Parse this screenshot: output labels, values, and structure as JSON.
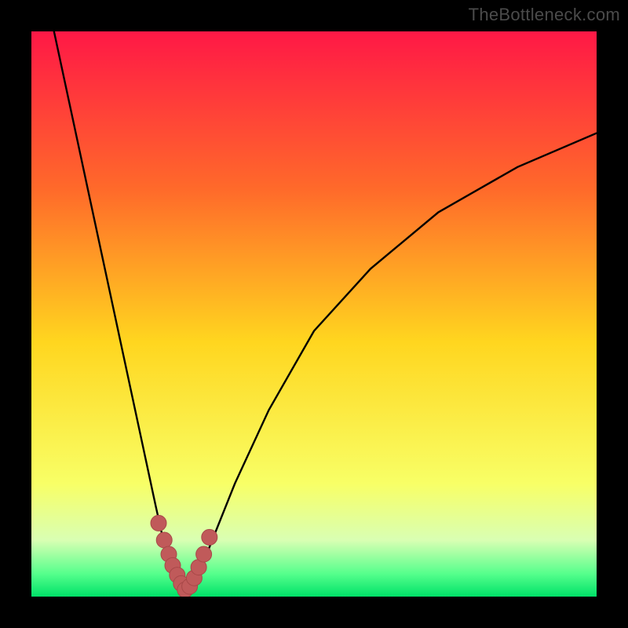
{
  "watermark": "TheBottleneck.com",
  "colors": {
    "grad_top": "#ff1846",
    "grad_upper": "#ff6a2a",
    "grad_mid": "#ffd61f",
    "grad_lower": "#f8ff66",
    "grad_band1": "#d9ffb3",
    "grad_band2": "#55ff8c",
    "grad_bottom": "#00e168",
    "curve": "#000000",
    "marker_fill": "#c05a5a",
    "marker_stroke": "#a84848",
    "frame": "#000000"
  },
  "chart_data": {
    "type": "line",
    "title": "",
    "xlabel": "",
    "ylabel": "",
    "xlim": [
      0,
      100
    ],
    "ylim": [
      0,
      100
    ],
    "grid": false,
    "legend": null,
    "comment": "No axis ticks or labels shown; values are relative percentages inferred from curve geometry. Minimum (zero bottleneck) near x≈27.",
    "series": [
      {
        "name": "curve",
        "x": [
          4,
          7,
          10,
          13,
          16,
          19,
          22,
          24,
          25,
          26,
          27,
          28,
          29,
          30,
          32,
          36,
          42,
          50,
          60,
          72,
          86,
          100
        ],
        "y": [
          100,
          86,
          72,
          58,
          44,
          30,
          16,
          7,
          4,
          2,
          0.5,
          1.5,
          3,
          5,
          10,
          20,
          33,
          47,
          58,
          68,
          76,
          82
        ]
      },
      {
        "name": "highlight_markers",
        "x": [
          22.5,
          23.5,
          24.3,
          25.0,
          25.8,
          26.5,
          27.2,
          28.0,
          28.8,
          29.6,
          30.5,
          31.5
        ],
        "y": [
          13.0,
          10.0,
          7.5,
          5.5,
          3.8,
          2.3,
          1.2,
          1.8,
          3.3,
          5.2,
          7.5,
          10.5
        ]
      }
    ]
  }
}
